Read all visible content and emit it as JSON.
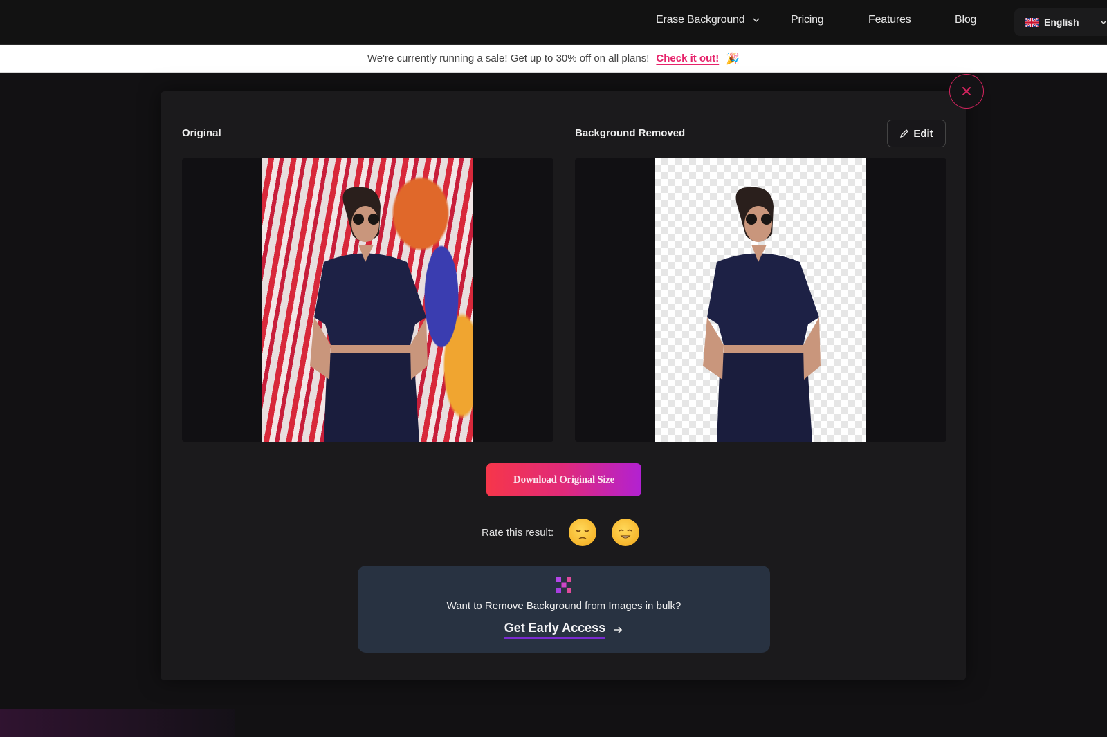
{
  "nav": {
    "items": [
      {
        "label": "Erase Background",
        "has_dropdown": true
      },
      {
        "label": "Pricing"
      },
      {
        "label": "Features"
      },
      {
        "label": "Blog"
      }
    ],
    "language": {
      "label": "English",
      "flag": "uk-flag-icon"
    }
  },
  "banner": {
    "text": "We're currently running a sale! Get up to 30% off on all plans!",
    "link_label": "Check it out!",
    "emoji": "🎉"
  },
  "modal": {
    "close_icon": "close-icon",
    "original_title": "Original",
    "removed_title": "Background Removed",
    "edit_label": "Edit",
    "download_label": "Download Original Size",
    "rate_label": "Rate this result:",
    "rating_options": [
      "sad-face",
      "happy-face"
    ],
    "bulk": {
      "text": "Want to Remove Background from Images in bulk?",
      "link_label": "Get Early Access"
    }
  },
  "colors": {
    "accent": "#e6226a",
    "close_ring": "#d3245e",
    "gradient_start": "#f6364a",
    "gradient_end": "#b221d2",
    "bulk_card": "#283241"
  }
}
